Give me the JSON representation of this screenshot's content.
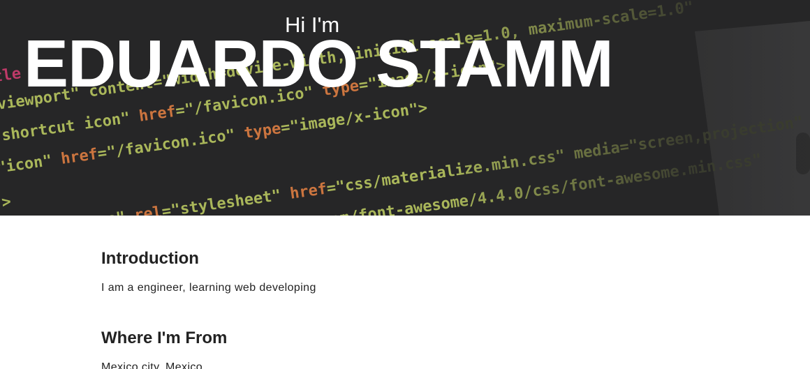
{
  "hero": {
    "greeting": "Hi I'm",
    "name": "EDUARDO STAMM"
  },
  "sections": [
    {
      "title": "Introduction",
      "text": "I am a engineer, learning web developing"
    },
    {
      "title": "Where I'm From",
      "text": "Mexico city, Mexico"
    }
  ],
  "colors": {
    "hero_background": "#2d2d2e",
    "page_background": "#ffffff",
    "heading_text": "#222222",
    "hero_text": "#ffffff"
  }
}
